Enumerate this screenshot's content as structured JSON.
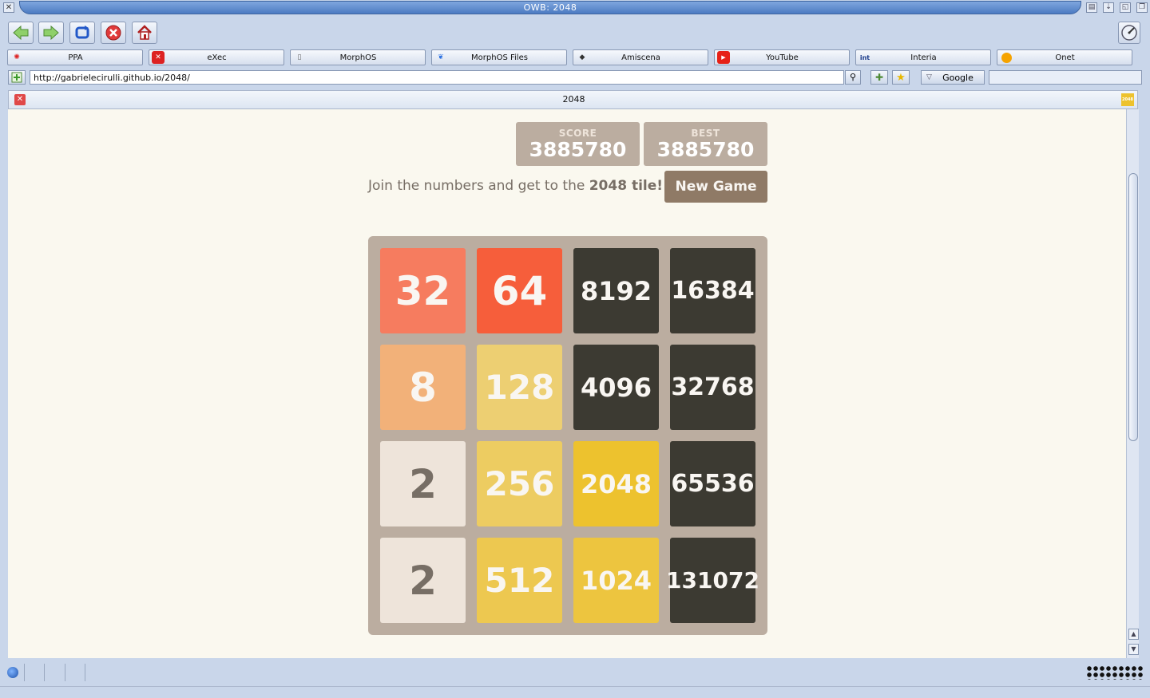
{
  "window": {
    "title": "OWB: 2048"
  },
  "bookmarks": [
    {
      "label": "PPA",
      "icon": "ppa-icon"
    },
    {
      "label": "eXec",
      "icon": "exec-icon"
    },
    {
      "label": "MorphOS",
      "icon": "document-icon"
    },
    {
      "label": "MorphOS Files",
      "icon": "butterfly-icon"
    },
    {
      "label": "Amiscena",
      "icon": "amiscena-icon"
    },
    {
      "label": "YouTube",
      "icon": "youtube-icon"
    },
    {
      "label": "Interia",
      "icon": "interia-icon"
    },
    {
      "label": "Onet",
      "icon": "onet-icon"
    }
  ],
  "urlbar": {
    "url": "http://gabrielecirulli.github.io/2048/",
    "search_engine": "Google"
  },
  "tab": {
    "title": "2048",
    "favicon_text": "2048"
  },
  "game": {
    "score_label": "SCORE",
    "score": "3885780",
    "best_label": "BEST",
    "best": "3885780",
    "intro_text": "Join the numbers and get to the ",
    "intro_bold": "2048 tile!",
    "new_game_label": "New Game",
    "grid": [
      [
        "32",
        "64",
        "8192",
        "16384"
      ],
      [
        "8",
        "128",
        "4096",
        "32768"
      ],
      [
        "2",
        "256",
        "2048",
        "65536"
      ],
      [
        "2",
        "512",
        "1024",
        "131072"
      ]
    ]
  },
  "colors": {
    "page_background": "#faf8ef",
    "board": "#bbada0",
    "tile_2": "#eee4da",
    "tile_8": "#f2b179",
    "tile_32": "#f67c5f",
    "tile_64": "#f65e3b",
    "tile_128": "#edcf72",
    "tile_256": "#edcc61",
    "tile_512": "#edc850",
    "tile_1024": "#edc53f",
    "tile_2048": "#edc22e",
    "tile_super": "#3c3a32",
    "dark_text": "#776e65",
    "light_text": "#f9f6f2"
  }
}
